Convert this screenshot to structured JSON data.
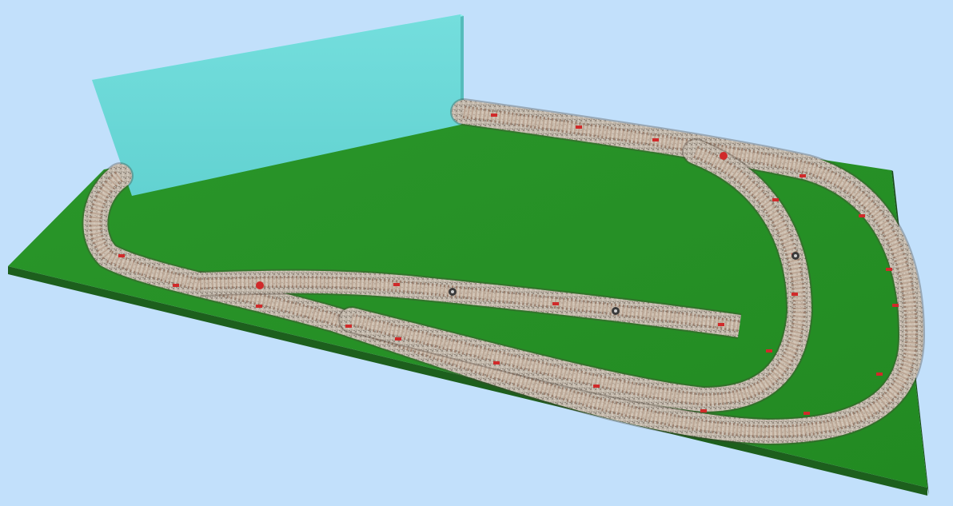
{
  "scene": {
    "view": "3d-layout-viewport",
    "colors": {
      "background": "#c2e0fb",
      "board_top": "#268f26",
      "board_front": "#1d5f1d",
      "board_right": "#1a4d1a",
      "backdrop_front": "#6ad7d6",
      "backdrop_top": "#8ff0ee",
      "backdrop_side": "#55bcbb",
      "ballast": "#b5a99a",
      "tie": "#8d6b58",
      "rail": "#c9b6a6",
      "marker": "#d02a2a",
      "signal": "#3a3a3a"
    },
    "objects": [
      {
        "name": "baseboard",
        "kind": "terrain",
        "color": "board_top"
      },
      {
        "name": "sky-backdrop",
        "kind": "backdrop",
        "color": "backdrop_front"
      },
      {
        "name": "outer-loop-track",
        "kind": "track"
      },
      {
        "name": "inner-loop-track",
        "kind": "track"
      },
      {
        "name": "siding-track",
        "kind": "track"
      },
      {
        "name": "turnout-left",
        "kind": "turnout"
      },
      {
        "name": "turnout-right",
        "kind": "turnout"
      },
      {
        "name": "track-signal-1",
        "kind": "signal"
      },
      {
        "name": "track-signal-2",
        "kind": "signal"
      },
      {
        "name": "track-signal-3",
        "kind": "signal"
      }
    ]
  }
}
